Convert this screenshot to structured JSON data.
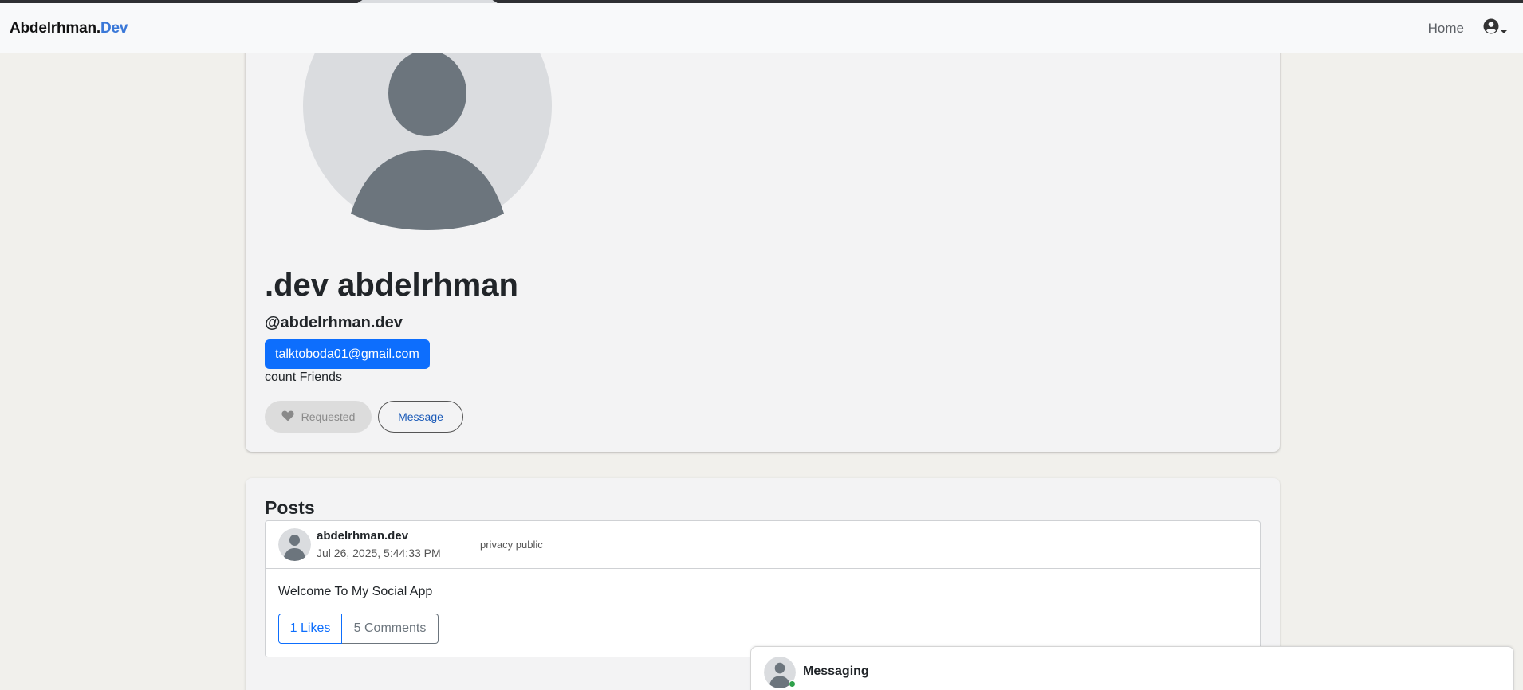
{
  "navbar": {
    "brand_main": "Abdelrhman.",
    "brand_accent": "Dev",
    "home_label": "Home",
    "user_icon": "user-circle-icon",
    "caret_icon": "caret-down-icon"
  },
  "profile": {
    "name": ".dev abdelrhman",
    "handle": "@abdelrhman.dev",
    "email": "talktoboda01@gmail.com",
    "friends_text": "count Friends",
    "requested_label": "Requested",
    "requested_icon": "heart-icon",
    "message_label": "Message"
  },
  "posts": {
    "title": "Posts",
    "items": [
      {
        "author": "abdelrhman.dev",
        "date": "Jul 26, 2025, 5:44:33 PM",
        "privacy": "privacy public",
        "text": "Welcome To My Social App",
        "likes_label": "1 Likes",
        "comments_label": "5 Comments"
      }
    ]
  },
  "messaging": {
    "title": "Messaging"
  },
  "colors": {
    "accent": "#3a78d8",
    "primary": "#0d6efd",
    "online": "#2fa14b"
  }
}
